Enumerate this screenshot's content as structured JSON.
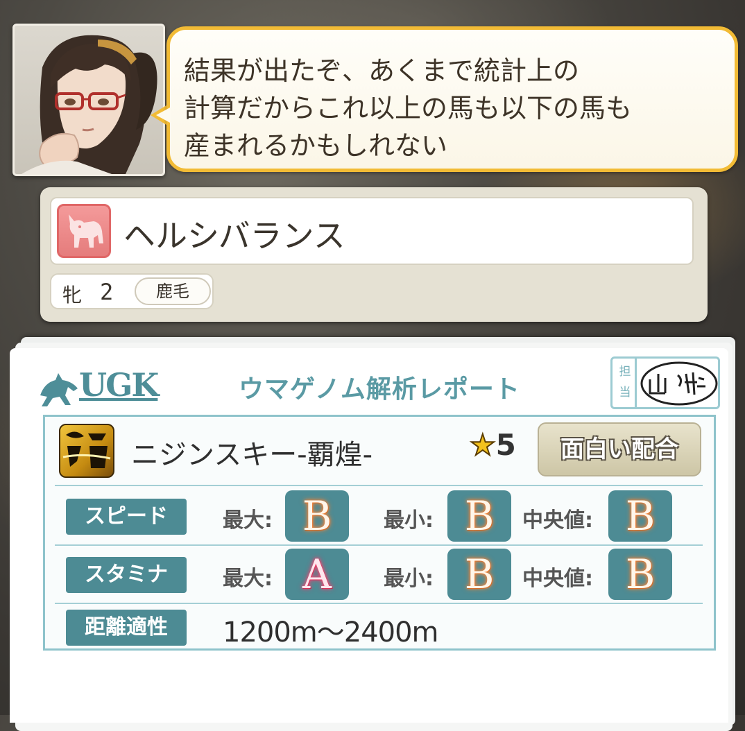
{
  "dialogue": {
    "text": "結果が出たぞ、あくまで統計上の\n計算だからこれ以上の馬も以下の馬も\n産まれるかもしれない"
  },
  "horse": {
    "name": "ヘルシバランス",
    "sex": "牝",
    "age": "2",
    "coat": "鹿毛",
    "icon": "horse-silhouette-icon"
  },
  "report": {
    "logo_text": "UGK",
    "title": "ウマゲノム解析レポート",
    "stamp_label": "担当",
    "signature": "山科",
    "factor": {
      "icon": "factor-gold-icon",
      "icon_text": "流 極",
      "name": "ニジンスキー-覇煌-",
      "star_glyph": "★",
      "stars": "5",
      "badge": "面白い配合"
    },
    "stats": [
      {
        "label": "スピード",
        "max_label": "最大:",
        "max": "B",
        "min_label": "最小:",
        "min": "B",
        "median_label": "中央値:",
        "median": "B"
      },
      {
        "label": "スタミナ",
        "max_label": "最大:",
        "max": "A",
        "min_label": "最小:",
        "min": "B",
        "median_label": "中央値:",
        "median": "B"
      }
    ],
    "distance": {
      "label": "距離適性",
      "value": "1200m〜2400m"
    }
  },
  "colors": {
    "accent_teal": "#4d8b94",
    "bubble_border": "#f2bb35",
    "horse_icon_bg": "#f49a9a"
  }
}
